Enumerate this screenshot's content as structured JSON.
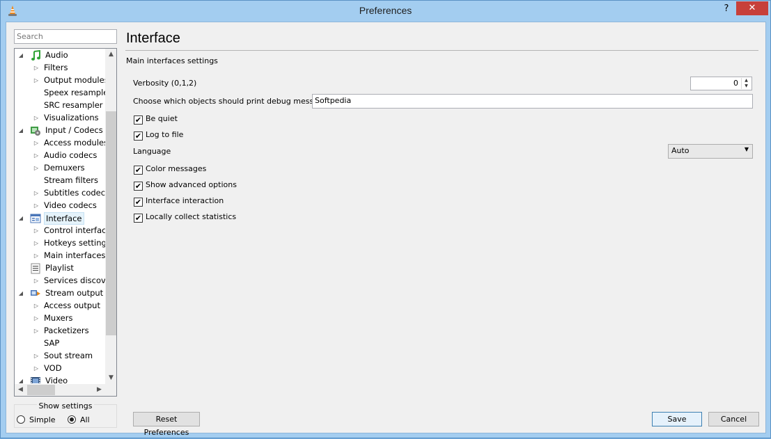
{
  "window": {
    "title": "Preferences",
    "help_glyph": "?",
    "close_glyph": "✕"
  },
  "search": {
    "placeholder": "Search"
  },
  "tree": [
    {
      "label": "Audio",
      "level": 0,
      "expand": "open",
      "icon": "music-note-icon"
    },
    {
      "label": "Filters",
      "level": 1,
      "expand": "closed"
    },
    {
      "label": "Output modules",
      "level": 1,
      "expand": "closed"
    },
    {
      "label": "Speex resampler",
      "level": 1,
      "expand": "none"
    },
    {
      "label": "SRC resampler",
      "level": 1,
      "expand": "none"
    },
    {
      "label": "Visualizations",
      "level": 1,
      "expand": "closed"
    },
    {
      "label": "Input / Codecs",
      "level": 0,
      "expand": "open",
      "icon": "codec-icon"
    },
    {
      "label": "Access modules",
      "level": 1,
      "expand": "closed"
    },
    {
      "label": "Audio codecs",
      "level": 1,
      "expand": "closed"
    },
    {
      "label": "Demuxers",
      "level": 1,
      "expand": "closed"
    },
    {
      "label": "Stream filters",
      "level": 1,
      "expand": "none"
    },
    {
      "label": "Subtitles codecs",
      "level": 1,
      "expand": "closed"
    },
    {
      "label": "Video codecs",
      "level": 1,
      "expand": "closed"
    },
    {
      "label": "Interface",
      "level": 0,
      "expand": "open",
      "icon": "interface-window-icon",
      "selected": true
    },
    {
      "label": "Control interfaces",
      "level": 1,
      "expand": "closed"
    },
    {
      "label": "Hotkeys settings",
      "level": 1,
      "expand": "closed"
    },
    {
      "label": "Main interfaces",
      "level": 1,
      "expand": "closed"
    },
    {
      "label": "Playlist",
      "level": 0,
      "expand": "none",
      "icon": "playlist-icon"
    },
    {
      "label": "Services discovery",
      "level": 1,
      "expand": "closed"
    },
    {
      "label": "Stream output",
      "level": 0,
      "expand": "open",
      "icon": "stream-output-icon"
    },
    {
      "label": "Access output",
      "level": 1,
      "expand": "closed"
    },
    {
      "label": "Muxers",
      "level": 1,
      "expand": "closed"
    },
    {
      "label": "Packetizers",
      "level": 1,
      "expand": "closed"
    },
    {
      "label": "SAP",
      "level": 1,
      "expand": "none"
    },
    {
      "label": "Sout stream",
      "level": 1,
      "expand": "closed"
    },
    {
      "label": "VOD",
      "level": 1,
      "expand": "closed"
    },
    {
      "label": "Video",
      "level": 0,
      "expand": "open",
      "icon": "film-icon"
    }
  ],
  "show_settings": {
    "title": "Show settings",
    "simple": "Simple",
    "all": "All",
    "selected": "All"
  },
  "panel": {
    "title": "Interface",
    "group_label": "Main interfaces settings",
    "verbosity_label": "Verbosity (0,1,2)",
    "verbosity_value": "0",
    "debug_label": "Choose which objects should print debug message",
    "debug_value": "Softpedia",
    "be_quiet": "Be quiet",
    "log_to_file": "Log to file",
    "language_label": "Language",
    "language_value": "Auto",
    "color_messages": "Color messages",
    "show_advanced": "Show advanced options",
    "interface_interaction": "Interface interaction",
    "collect_stats": "Locally collect statistics"
  },
  "buttons": {
    "reset": "Reset Preferences",
    "save": "Save",
    "cancel": "Cancel"
  }
}
